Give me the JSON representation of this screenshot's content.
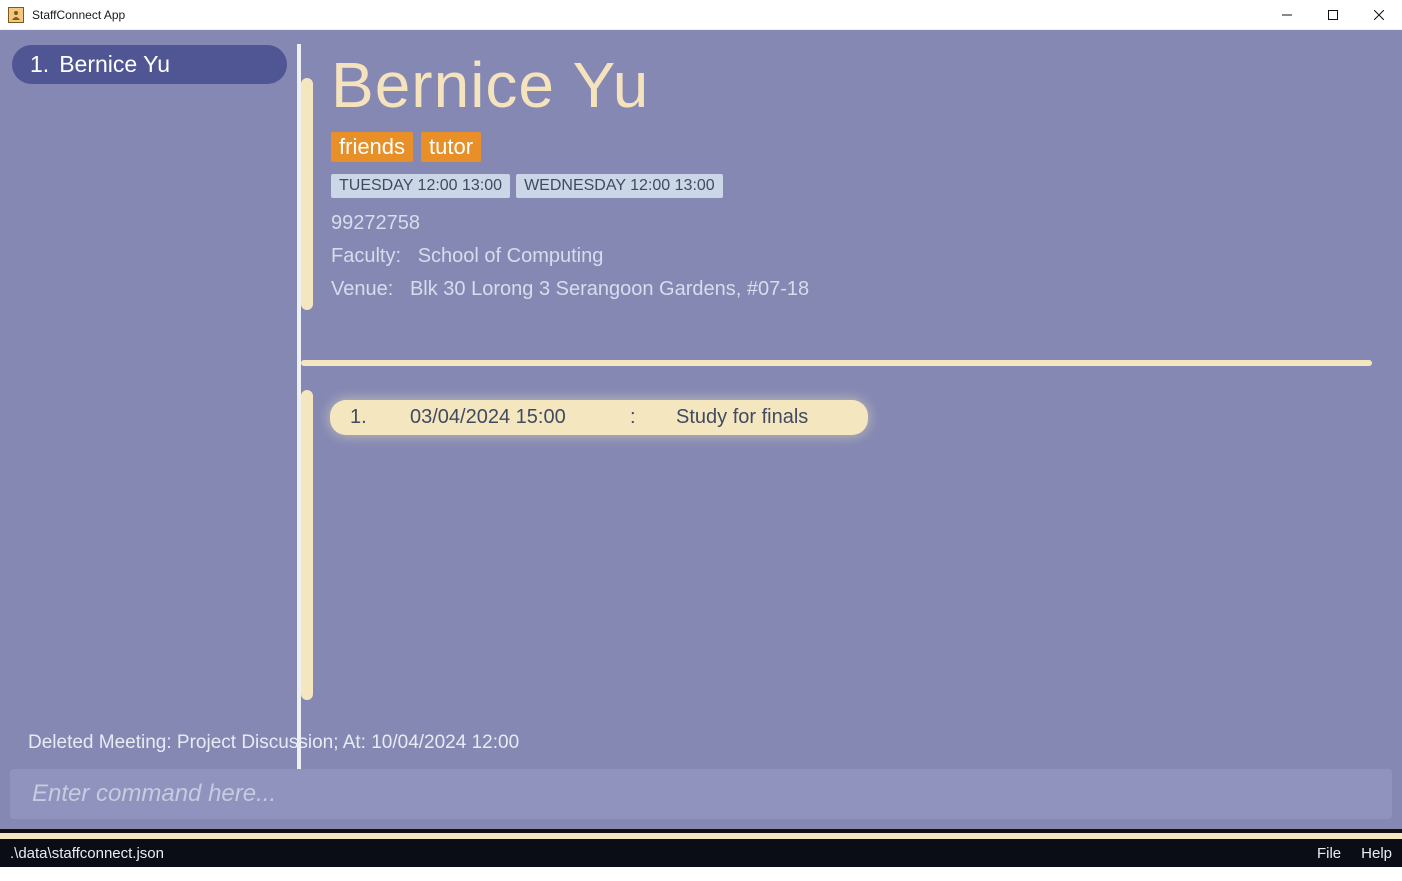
{
  "window": {
    "title": "StaffConnect App"
  },
  "sidebar": {
    "items": [
      {
        "index": "1.",
        "name": "Bernice Yu"
      }
    ]
  },
  "detail": {
    "name": "Bernice Yu",
    "tags": [
      "friends",
      "tutor"
    ],
    "slots": [
      "TUESDAY 12:00 13:00",
      "WEDNESDAY 12:00 13:00"
    ],
    "phone": "99272758",
    "faculty_label": "Faculty:",
    "faculty_value": "School of Computing",
    "venue_label": "Venue:",
    "venue_value": "Blk 30 Lorong 3 Serangoon Gardens, #07-18"
  },
  "meetings": [
    {
      "index": "1.",
      "datetime": "03/04/2024 15:00",
      "sep": ":",
      "desc": "Study for finals"
    }
  ],
  "feedback": "Deleted Meeting: Project Discussion; At: 10/04/2024 12:00",
  "command": {
    "placeholder": "Enter command here..."
  },
  "statusbar": {
    "path": ".\\data\\staffconnect.json",
    "menus": [
      "File",
      "Help"
    ]
  }
}
